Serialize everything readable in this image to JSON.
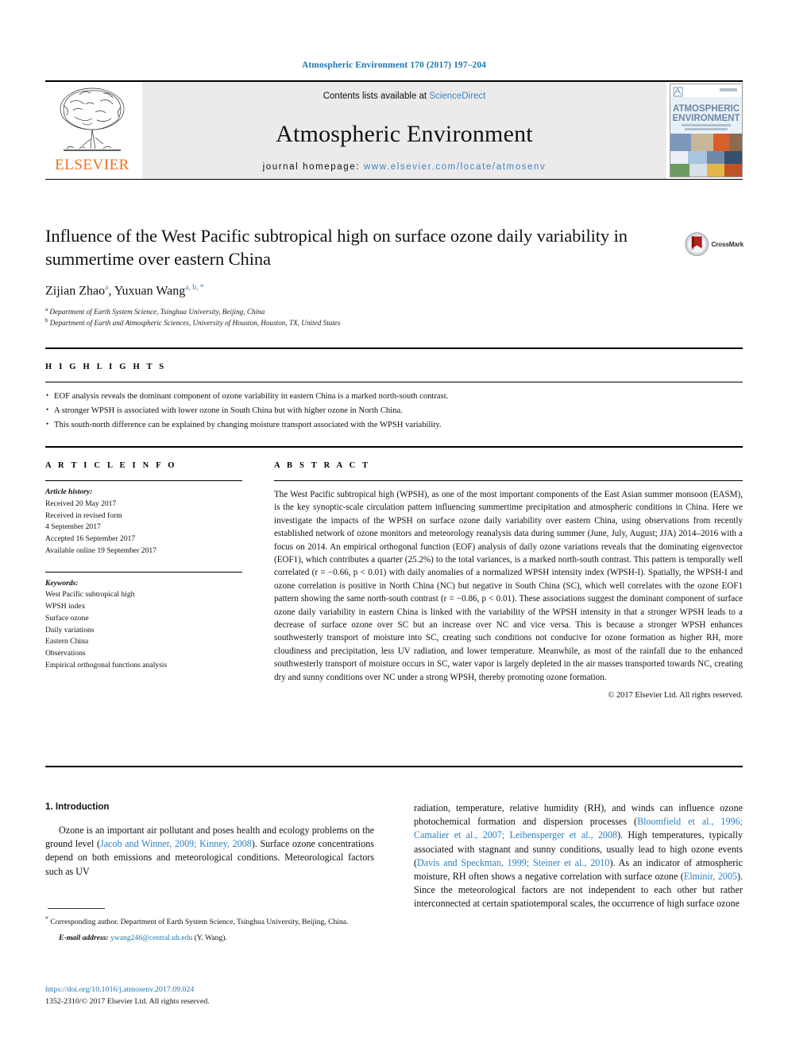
{
  "running_head": "Atmospheric Environment 170 (2017) 197–204",
  "masthead": {
    "publisher_name": "ELSEVIER",
    "contents_prefix": "Contents lists available at ",
    "contents_link": "ScienceDirect",
    "journal_title": "Atmospheric Environment",
    "homepage_prefix": "journal homepage: ",
    "homepage_url": "www.elsevier.com/locate/atmosenv",
    "cover_title_line1": "ATMOSPHERIC",
    "cover_title_line2": "ENVIRONMENT",
    "accent_blue": "#3a86c8",
    "elsevier_orange": "#f06f1e"
  },
  "article": {
    "title": "Influence of the West Pacific subtropical high on surface ozone daily variability in summertime over eastern China",
    "authors": [
      {
        "name": "Zijian Zhao",
        "marks": "a"
      },
      {
        "name": "Yuxuan Wang",
        "marks": "a, b, *"
      }
    ],
    "affiliations": [
      {
        "mark": "a",
        "text": "Department of Earth System Science, Tsinghua University, Beijing, China"
      },
      {
        "mark": "b",
        "text": "Department of Earth and Atmospheric Sciences, University of Houston, Houston, TX, United States"
      }
    ],
    "crossmark_label": "CrossMark"
  },
  "highlights": {
    "heading": "H I G H L I G H T S",
    "items": [
      "EOF analysis reveals the dominant component of ozone variability in eastern China is a marked north-south contrast.",
      "A stronger WPSH is associated with lower ozone in South China but with higher ozone in North China.",
      "This south-north difference can be explained by changing moisture transport associated with the WPSH variability."
    ]
  },
  "article_info": {
    "heading": "A R T I C L E   I N F O",
    "history_label": "Article history:",
    "history": [
      "Received 20 May 2017",
      "Received in revised form",
      "4 September 2017",
      "Accepted 16 September 2017",
      "Available online 19 September 2017"
    ],
    "keywords_label": "Keywords:",
    "keywords": [
      "West Pacific subtropical high",
      "WPSH index",
      "Surface ozone",
      "Daily variations",
      "Eastern China",
      "Observations",
      "Empirical orthogonal functions analysis"
    ]
  },
  "abstract": {
    "heading": "A B S T R A C T",
    "text": "The West Pacific subtropical high (WPSH), as one of the most important components of the East Asian summer monsoon (EASM), is the key synoptic-scale circulation pattern influencing summertime precipitation and atmospheric conditions in China. Here we investigate the impacts of the WPSH on surface ozone daily variability over eastern China, using observations from recently established network of ozone monitors and meteorology reanalysis data during summer (June, July, August; JJA) 2014–2016 with a focus on 2014. An empirical orthogonal function (EOF) analysis of daily ozone variations reveals that the dominating eigenvector (EOF1), which contributes a quarter (25.2%) to the total variances, is a marked north-south contrast. This pattern is temporally well correlated (r = −0.66, p < 0.01) with daily anomalies of a normalized WPSH intensity index (WPSH-I). Spatially, the WPSH-I and ozone correlation is positive in North China (NC) but negative in South China (SC), which well correlates with the ozone EOF1 pattern showing the same north-south contrast (r = −0.86, p < 0.01). These associations suggest the dominant component of surface ozone daily variability in eastern China is linked with the variability of the WPSH intensity in that a stronger WPSH leads to a decrease of surface ozone over SC but an increase over NC and vice versa. This is because a stronger WPSH enhances southwesterly transport of moisture into SC, creating such conditions not conducive for ozone formation as higher RH, more cloudiness and precipitation, less UV radiation, and lower temperature. Meanwhile, as most of the rainfall due to the enhanced southwesterly transport of moisture occurs in SC, water vapor is largely depleted in the air masses transported towards NC, creating dry and sunny conditions over NC under a strong WPSH, thereby promoting ozone formation.",
    "copyright": "© 2017 Elsevier Ltd. All rights reserved."
  },
  "introduction": {
    "heading": "1.  Introduction",
    "left_para_segments": [
      {
        "t": "Ozone is an important air pollutant and poses health and ecology problems on the ground level (",
        "ref": false
      },
      {
        "t": "Jacob and Winner, 2009; Kinney, 2008",
        "ref": true
      },
      {
        "t": "). Surface ozone concentrations depend on both emissions and meteorological conditions. Meteorological factors such as UV",
        "ref": false
      }
    ],
    "right_para_segments": [
      {
        "t": "radiation, temperature, relative humidity (RH), and winds can influence ozone photochemical formation and dispersion processes (",
        "ref": false
      },
      {
        "t": "Bloomfield et al., 1996; Camalier et al., 2007; Leibensperger et al., 2008",
        "ref": true
      },
      {
        "t": "). High temperatures, typically associated with stagnant and sunny conditions, usually lead to high ozone events (",
        "ref": false
      },
      {
        "t": "Davis and Speckman, 1999; Steiner et al., 2010",
        "ref": true
      },
      {
        "t": "). As an indicator of atmospheric moisture, RH often shows a negative correlation with surface ozone (",
        "ref": false
      },
      {
        "t": "Elminir, 2005",
        "ref": true
      },
      {
        "t": "). Since the meteorological factors are not independent to each other but rather interconnected at certain spatiotemporal scales, the occurrence of high surface ozone",
        "ref": false
      }
    ]
  },
  "footer": {
    "corresponding_star": "*",
    "corresponding_text": " Corresponding author. Department of Earth System Science, Tsinghua University, Beijing, China.",
    "email_label": "E-mail address:",
    "email_address": "ywang246@central.uh.edu",
    "email_owner": "(Y. Wang).",
    "doi": "https://doi.org/10.1016/j.atmosenv.2017.09.024",
    "issn_line": "1352-2310/© 2017 Elsevier Ltd. All rights reserved."
  }
}
